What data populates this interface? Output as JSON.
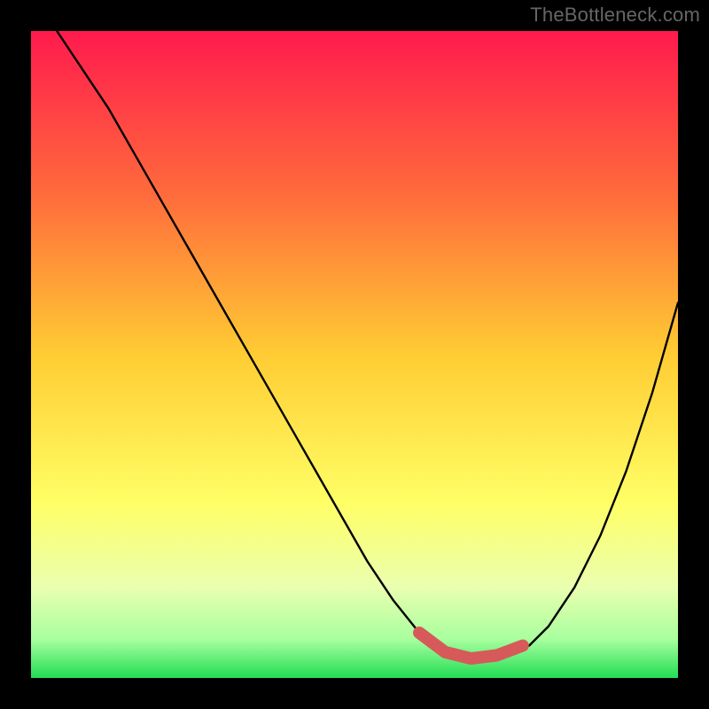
{
  "watermark": "TheBottleneck.com",
  "colors": {
    "page_bg": "#000000",
    "curve": "#000000",
    "highlight": "#d65a5a",
    "watermark": "#666666",
    "gradient_stops": [
      {
        "offset": "0%",
        "color": "#ff1a4d"
      },
      {
        "offset": "25%",
        "color": "#ff6a3c"
      },
      {
        "offset": "50%",
        "color": "#ffcc33"
      },
      {
        "offset": "73%",
        "color": "#ffff66"
      },
      {
        "offset": "86%",
        "color": "#eaffb0"
      },
      {
        "offset": "94%",
        "color": "#a8ff9e"
      },
      {
        "offset": "100%",
        "color": "#22dd55"
      }
    ]
  },
  "chart_data": {
    "type": "line",
    "title": "",
    "xlabel": "",
    "ylabel": "",
    "xlim": [
      0,
      100
    ],
    "ylim": [
      0,
      100
    ],
    "series": [
      {
        "name": "bottleneck-curve",
        "x": [
          4,
          8,
          12,
          16,
          20,
          24,
          28,
          32,
          36,
          40,
          44,
          48,
          52,
          56,
          60,
          62,
          66,
          70,
          74,
          77,
          80,
          84,
          88,
          92,
          96,
          100
        ],
        "y": [
          100,
          94,
          88,
          81,
          74,
          67,
          60,
          53,
          46,
          39,
          32,
          25,
          18,
          12,
          7,
          5,
          3,
          3,
          4,
          5,
          8,
          14,
          22,
          32,
          44,
          58
        ]
      }
    ],
    "highlight_range": {
      "name": "optimal-range",
      "x": [
        60,
        64,
        68,
        72,
        76
      ],
      "y": [
        7,
        4,
        3,
        3.5,
        5
      ]
    }
  }
}
